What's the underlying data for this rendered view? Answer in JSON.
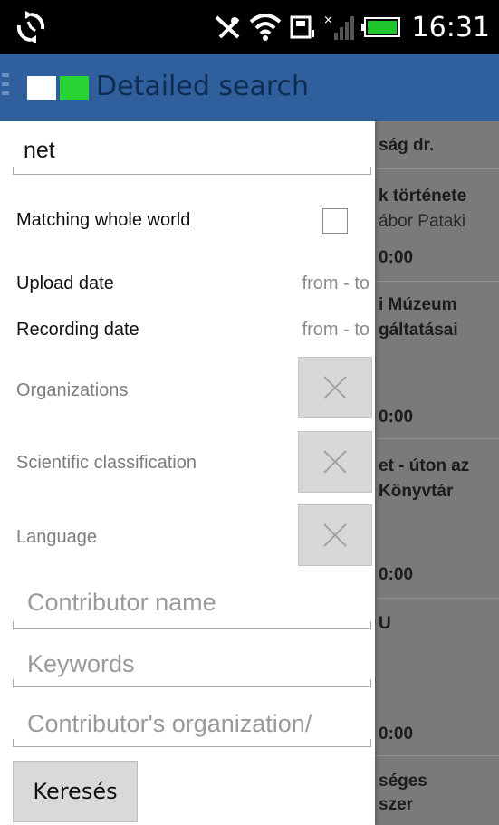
{
  "status_bar": {
    "time": "16:31",
    "icons": [
      "sync-icon",
      "vibrate-icon",
      "wifi-icon",
      "sd-card-icon",
      "signal-icon",
      "battery-icon"
    ]
  },
  "action_bar": {
    "title": "Detailed search"
  },
  "drawer": {
    "search_value": "net",
    "matching_label": "Matching whole world",
    "upload_label": "Upload date",
    "upload_value": "from - to",
    "recording_label": "Recording date",
    "recording_value": "from - to",
    "organizations_label": "Organizations",
    "classification_label": "Scientific classification",
    "language_label": "Language",
    "contributor_placeholder": "Contributor name",
    "keywords_placeholder": "Keywords",
    "organization_placeholder": "Contributor's organization/",
    "search_button": "Keresés"
  },
  "background_list": {
    "items": [
      "ság dr.",
      "k története",
      "ábor Pataki",
      "0:00",
      "i Múzeum",
      "gáltatásai",
      "0:00",
      "et - úton az",
      "Könyvtár",
      "0:00",
      "U",
      "0:00",
      "séges",
      "szer"
    ]
  },
  "colors": {
    "action_bar": "#2f5f9d",
    "logo_green": "#27d434"
  }
}
